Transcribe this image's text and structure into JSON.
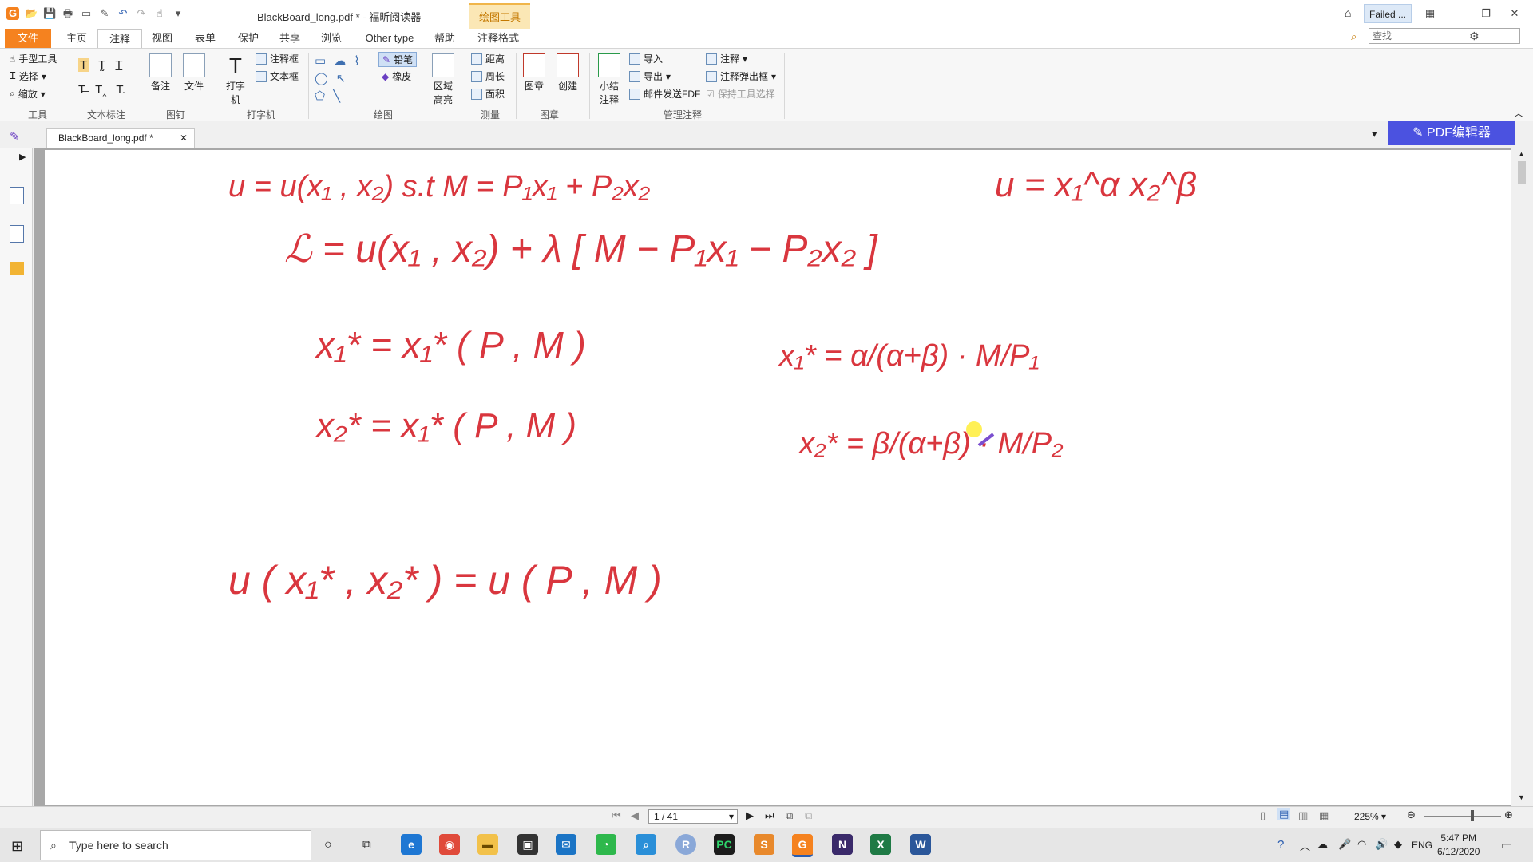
{
  "window": {
    "title": "BlackBoard_long.pdf * - 福昕阅读器",
    "context_tab": "绘图工具",
    "failed_label": "Failed ...",
    "search_placeholder": "查找"
  },
  "tabs": [
    "文件",
    "主页",
    "注释",
    "视图",
    "表单",
    "保护",
    "共享",
    "浏览",
    "Other type",
    "帮助",
    "注释格式"
  ],
  "ribbon": {
    "tools": {
      "hand": "手型工具",
      "select": "选择",
      "zoom": "缩放",
      "group": "工具"
    },
    "text_markup": {
      "group": "文本标注"
    },
    "pin": {
      "note": "备注",
      "file": "文件",
      "group": "图钉"
    },
    "typewriter": {
      "typewriter": "打字机",
      "callout": "注释框",
      "textbox": "文本框",
      "group": "打字机"
    },
    "drawing": {
      "pencil": "铅笔",
      "eraser": "橡皮",
      "area_highlight": "区域高亮",
      "group": "绘图"
    },
    "measure": {
      "distance": "距离",
      "perimeter": "周长",
      "area": "面积",
      "group": "测量"
    },
    "stamp": {
      "stamp": "图章",
      "create": "创建",
      "group": "图章"
    },
    "manage": {
      "summary": "小结注释",
      "import": "导入",
      "export": "导出",
      "email": "邮件发送FDF",
      "comments": "注释",
      "popup": "注释弹出框",
      "keep_tool": "保持工具选择",
      "group": "管理注释"
    }
  },
  "document": {
    "tab_label": "BlackBoard_long.pdf *",
    "editor_button": "PDF编辑器"
  },
  "handwriting": {
    "line1": "u = u(x₁ , x₂)   s.t   M = P₁x₁ + P₂x₂",
    "line1_right": "u = x₁^α x₂^β",
    "line2": "ℒ = u(x₁ , x₂) + λ [ M − P₁x₁ − P₂x₂ ]",
    "line3": "x₁* = x₁* ( P , M )",
    "line3_right": "x₁* = α/(α+β) · M/P₁",
    "line4": "x₂* = x₁* ( P , M )",
    "line4_right": "x₂* = β/(α+β) · M/P₂",
    "line5": "u ( x₁* , x₂* )   =   u ( P , M )"
  },
  "status": {
    "page": "1 / 41",
    "zoom": "225%"
  },
  "taskbar": {
    "search_placeholder": "Type here to search",
    "language": "ENG",
    "time": "5:47 PM",
    "date": "6/12/2020"
  }
}
